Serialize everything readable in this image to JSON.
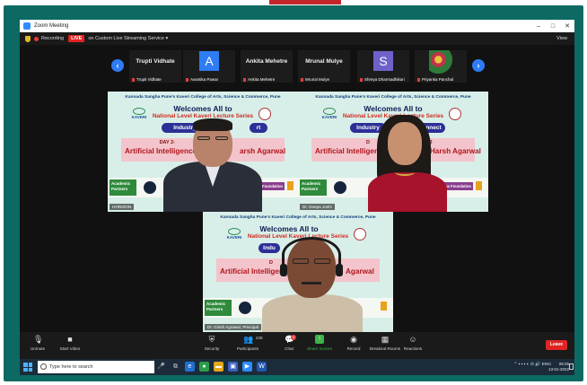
{
  "window": {
    "title": "Zoom Meeting",
    "controls": [
      "–",
      "□",
      "✕"
    ]
  },
  "meeting_bar": {
    "recording": "Recording",
    "live_badge": "LIVE",
    "live_service": "on Custom Live Streaming Service ▾",
    "view": "View"
  },
  "thumbnails": [
    {
      "name": "Trupti Vidhate",
      "caption": "Trupti Vidhate"
    },
    {
      "avatar": "A",
      "caption": "Avantika Pawar",
      "avatar_color": "#2e7cf6"
    },
    {
      "name": "Ankita Mehetre",
      "caption": "Ankita Mehetre"
    },
    {
      "name": "Mrunal Mulye",
      "caption": "Mrunal Mulye"
    },
    {
      "avatar": "S",
      "caption": "Shreya Dharmadhikari",
      "avatar_color": "#6e62c9"
    },
    {
      "caption": "Priyanka Panchal"
    }
  ],
  "banner": {
    "college": "Kannada Sangha Pune's Kaveri College of Arts, Science & Commerce, Pune",
    "kaveri": "KAVERI",
    "welcome": "Welcomes All to",
    "series": "National Level Kaveri Lecture Series",
    "partners_label": "Academic Partners"
  },
  "tiles": [
    {
      "label": "HORIZON",
      "pill": "Industry - Academia Connect",
      "pill_shown": "Industry -",
      "pill_tail": "rt",
      "day": "DAY 2-",
      "topic": "Artificial Intelligence",
      "topic_tail": "arsh Agarwal",
      "partner": "Skillmax Foundation"
    },
    {
      "label": "Dr. Deepa Joshi",
      "pill_shown": "Industry",
      "pill_tail": "onnect",
      "day": "D",
      "day_tail": "022",
      "topic": "Artificial Intelligence",
      "topic_tail": "A Harsh Agarwal",
      "partner": "Skillmax Foundation"
    },
    {
      "label": "Dr. Girish Agrawal, Principal",
      "pill_shown": "Indu",
      "day": "D",
      "topic": "Artificial Intelliger",
      "topic_tail": "Agarwal"
    }
  ],
  "toolbar": {
    "unmute": "Unmute",
    "start_video": "Start Video",
    "security": "Security",
    "participants": "Participants",
    "participants_count": "228",
    "chat": "Chat",
    "chat_badge": "3",
    "share_screen": "Share Screen",
    "record": "Record",
    "breakout": "Breakout Rooms",
    "reactions": "Reactions",
    "leave": "Leave"
  },
  "taskbar": {
    "search_placeholder": "Type here to search",
    "tray": "ENG",
    "time": "08:25",
    "date": "13-01-2022"
  }
}
